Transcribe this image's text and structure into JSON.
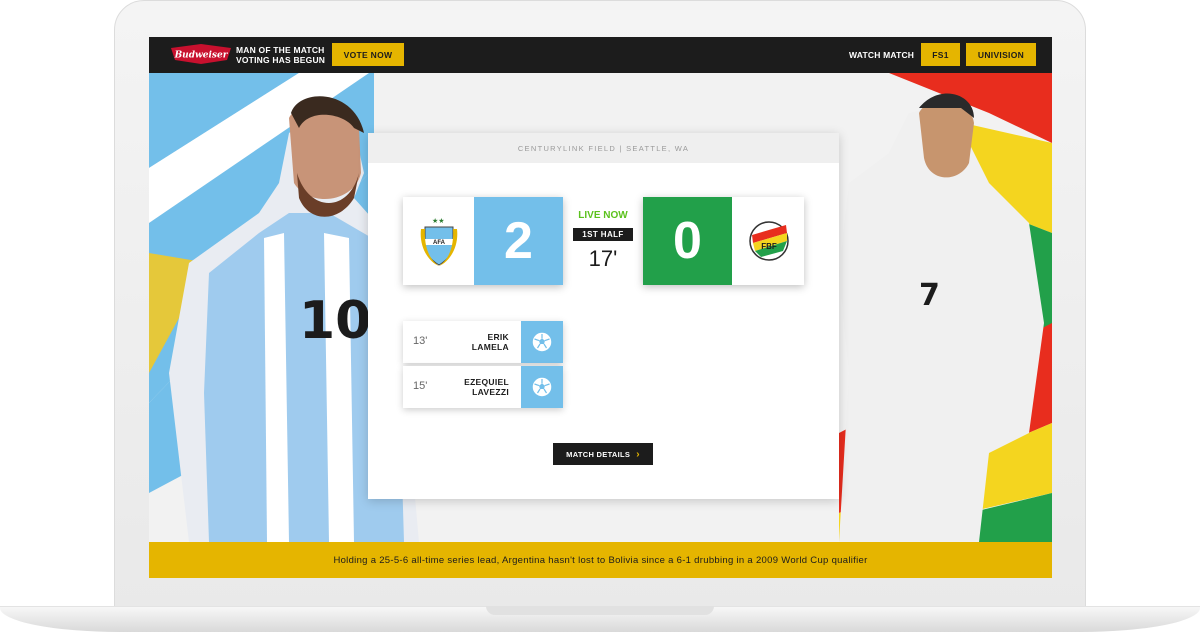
{
  "topbar": {
    "sponsor": "Budweiser",
    "promo_line1": "MAN OF THE MATCH",
    "promo_line2": "VOTING HAS BEGUN",
    "vote_label": "VOTE NOW",
    "watch_label": "WATCH MATCH",
    "channels": [
      "FS1",
      "UNIVISION"
    ]
  },
  "venue": "CENTURYLINK FIELD | SEATTLE, WA",
  "match": {
    "home": {
      "score": "2",
      "color": "#73bfea",
      "crest_icon": "argentina-crest-icon"
    },
    "away": {
      "score": "0",
      "color": "#22a04a",
      "crest_icon": "bolivia-crest-icon",
      "crest_text": "FBF"
    },
    "status": "LIVE NOW",
    "period": "1ST HALF",
    "minute": "17'"
  },
  "goals": [
    {
      "minute": "13'",
      "first": "ERIK",
      "last": "LAMELA"
    },
    {
      "minute": "15'",
      "first": "EZEQUIEL",
      "last": "LAVEZZI"
    }
  ],
  "details_label": "MATCH DETAILS",
  "ticker": "Holding a 25-5-6 all-time series lead, Argentina hasn't lost to Bolivia since a 6-1 drubbing in a 2009 World Cup qualifier",
  "colors": {
    "accent": "#e5b500",
    "dark": "#1c1c1c",
    "live": "#5cc21e"
  }
}
